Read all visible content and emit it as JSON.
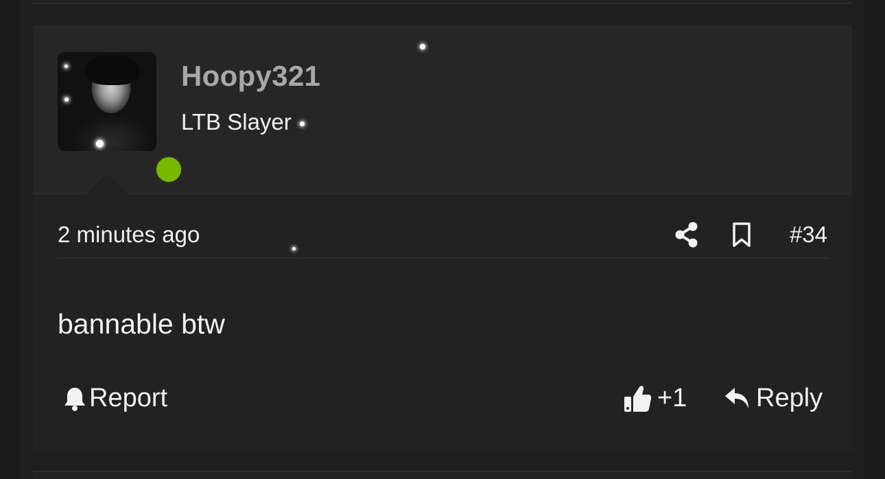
{
  "post": {
    "username": "Hoopy321",
    "user_title": "LTB Slayer",
    "timestamp": "2 minutes ago",
    "post_number": "#34",
    "body": "bannable btw",
    "status_color": "#7ab800",
    "online": true
  },
  "actions": {
    "report_label": "Report",
    "like_label": "+1",
    "reply_label": "Reply"
  },
  "icons": {
    "share": "share-icon",
    "bookmark": "bookmark-icon",
    "report": "bell-icon",
    "like": "thumbs-up-icon",
    "reply": "reply-arrow-icon"
  }
}
